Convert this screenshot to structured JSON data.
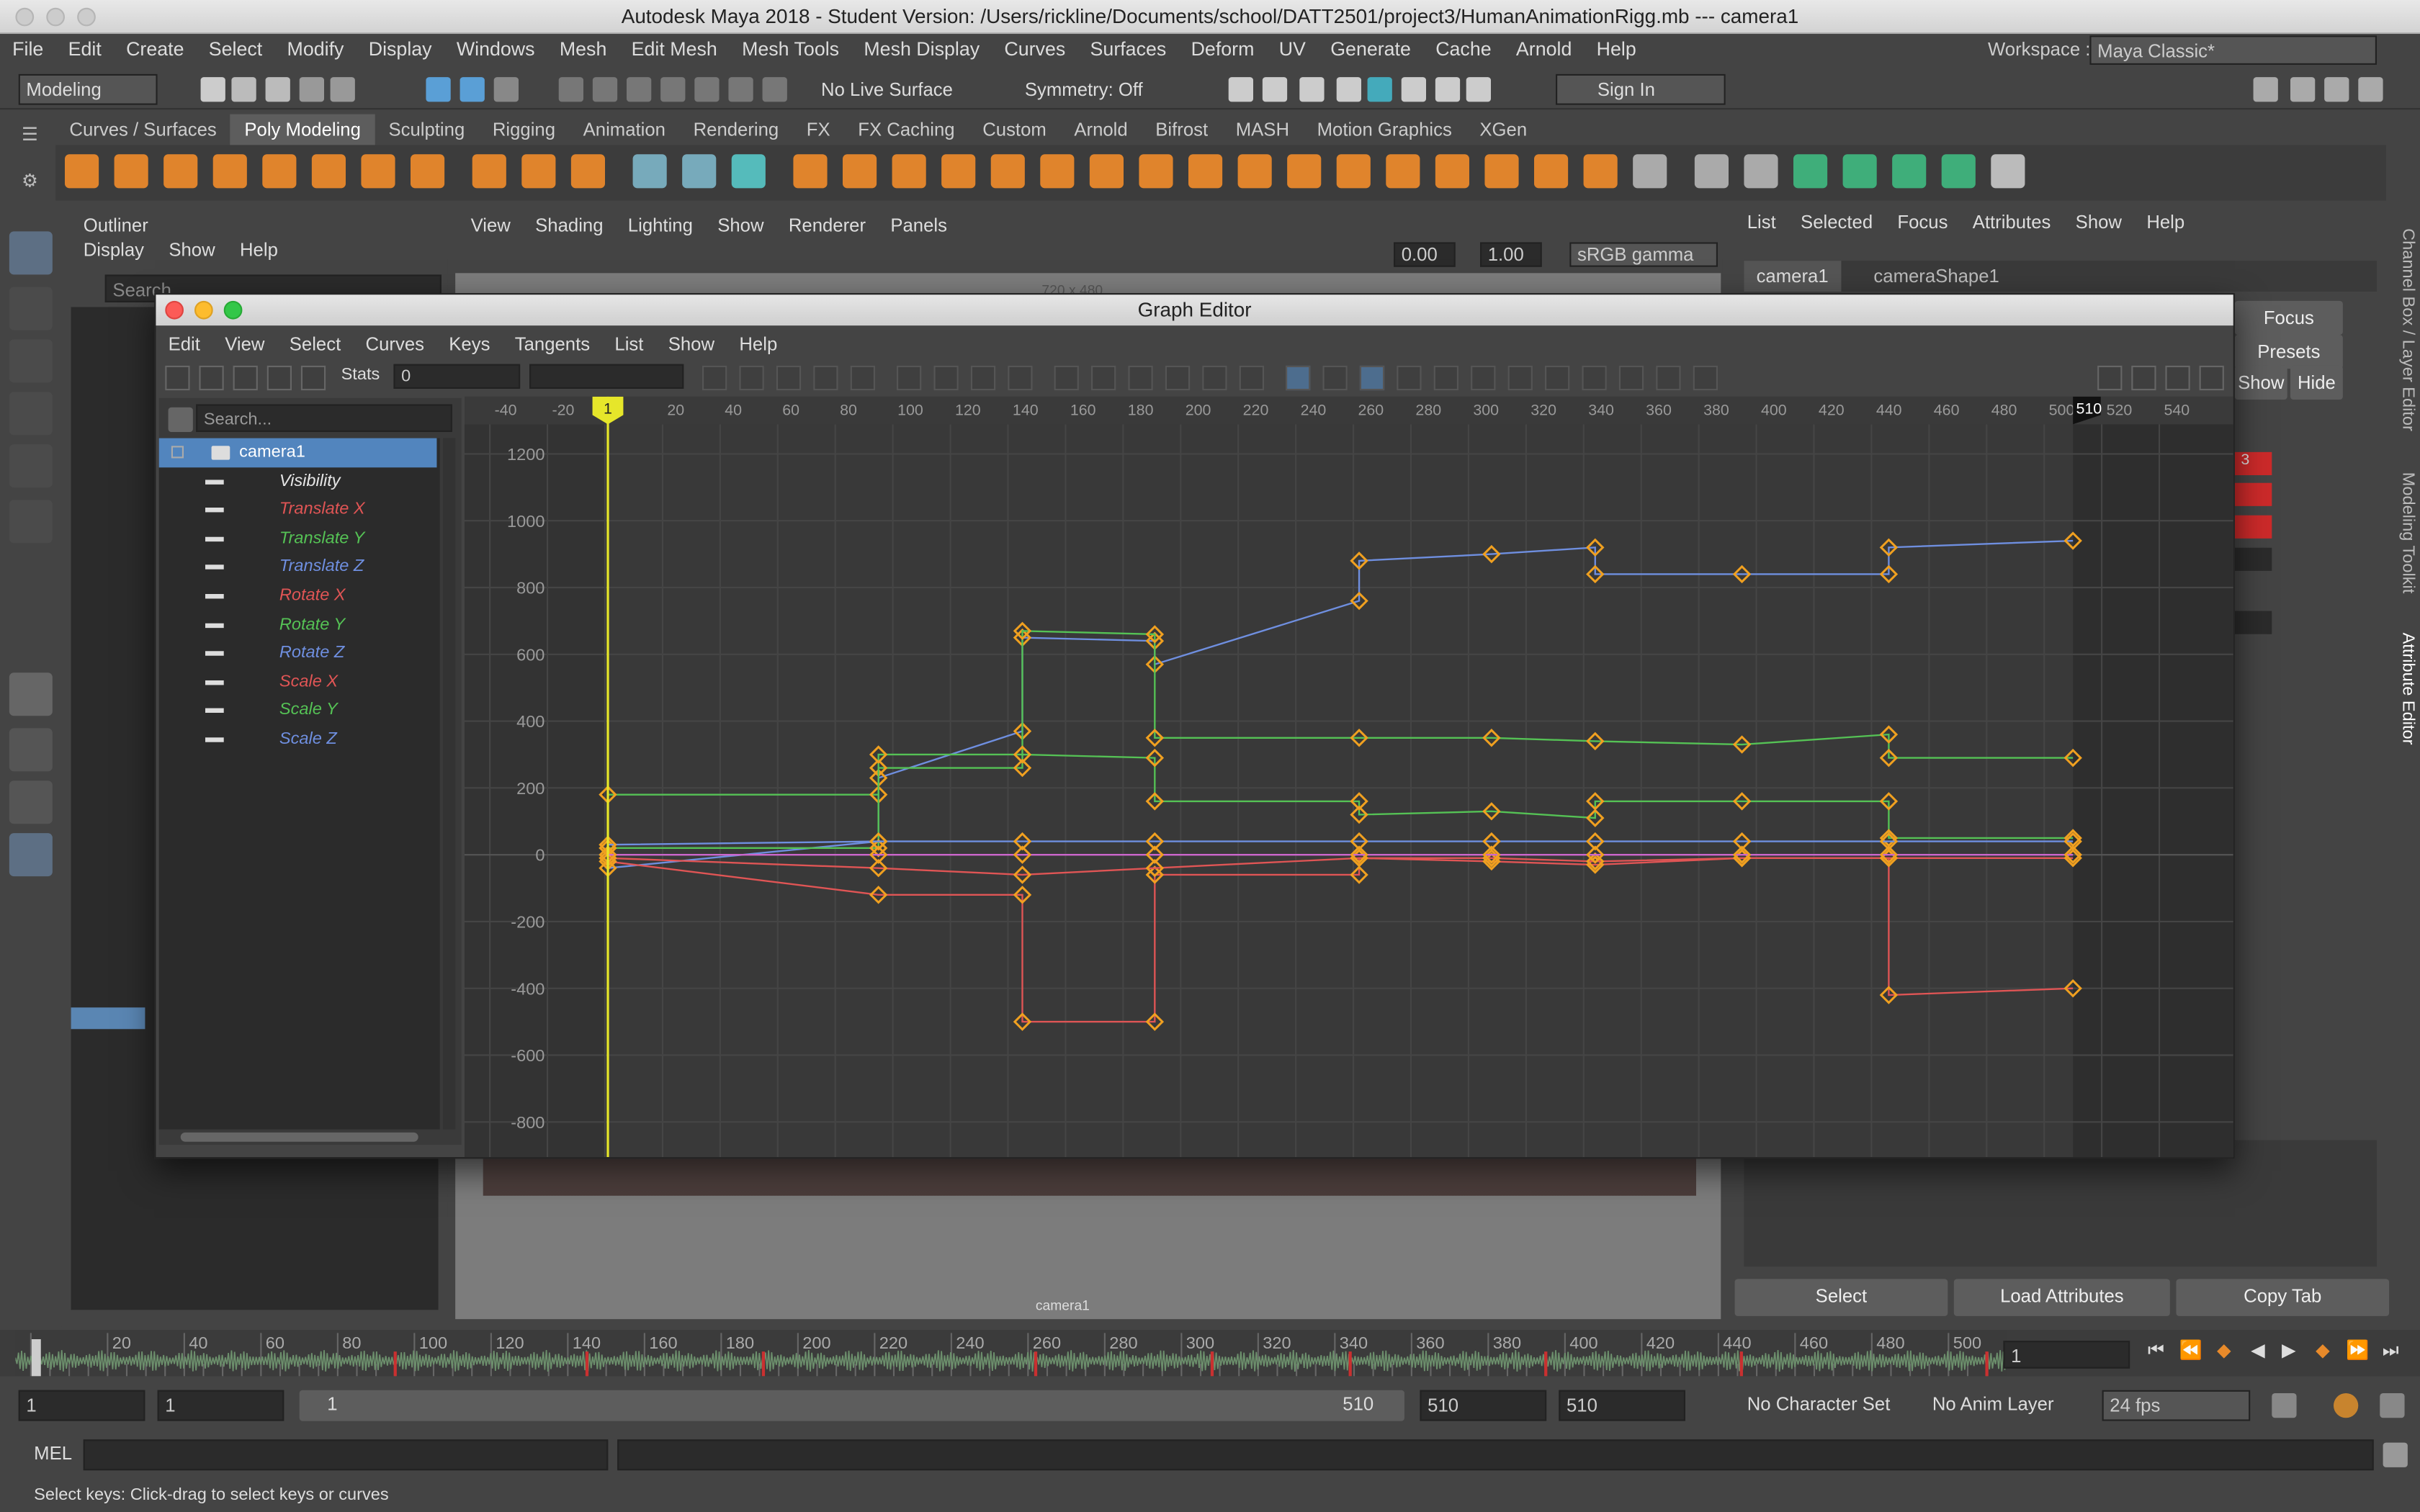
{
  "window": {
    "title": "Autodesk Maya 2018 - Student Version: /Users/rickline/Documents/school/DATT2501/project3/HumanAnimationRigg.mb   ---   camera1"
  },
  "menu": [
    "File",
    "Edit",
    "Create",
    "Select",
    "Modify",
    "Display",
    "Windows",
    "Mesh",
    "Edit Mesh",
    "Mesh Tools",
    "Mesh Display",
    "Curves",
    "Surfaces",
    "Deform",
    "UV",
    "Generate",
    "Cache",
    "Arnold",
    "Help"
  ],
  "workspace": {
    "label": "Workspace :",
    "value": "Maya Classic*"
  },
  "status": {
    "mode": "Modeling",
    "live_surface": "No Live Surface",
    "symmetry": "Symmetry: Off",
    "sign_in": "Sign In"
  },
  "shelf_tabs": [
    "Curves / Surfaces",
    "Poly Modeling",
    "Sculpting",
    "Rigging",
    "Animation",
    "Rendering",
    "FX",
    "FX Caching",
    "Custom",
    "Arnold",
    "Bifrost",
    "MASH",
    "Motion Graphics",
    "XGen"
  ],
  "outliner": {
    "title": "Outliner",
    "menu": [
      "Display",
      "Show",
      "Help"
    ],
    "search": "Search..."
  },
  "viewport": {
    "menu": [
      "View",
      "Shading",
      "Lighting",
      "Show",
      "Renderer",
      "Panels"
    ],
    "field1": "0.00",
    "field2": "1.00",
    "color_space": "sRGB gamma",
    "resolution": "720 x 480",
    "camera_label": "camera1"
  },
  "right_panel": {
    "menu": [
      "List",
      "Selected",
      "Focus",
      "Attributes",
      "Show",
      "Help"
    ],
    "tabs": [
      "camera1",
      "cameraShape1"
    ],
    "focus": "Focus",
    "presets": "Presets",
    "show": "Show",
    "hide": "Hide",
    "red_value": "3",
    "select": "Select",
    "load_attributes": "Load Attributes",
    "copy_tab": "Copy Tab"
  },
  "side_tabs": [
    "Channel Box / Layer Editor",
    "Modeling Toolkit",
    "Attribute Editor"
  ],
  "graph_editor": {
    "title": "Graph Editor",
    "menu": [
      "Edit",
      "View",
      "Select",
      "Curves",
      "Keys",
      "Tangents",
      "List",
      "Show",
      "Help"
    ],
    "stats_label": "Stats",
    "stats_value": "0",
    "search": "Search...",
    "object": "camera1",
    "channels": [
      {
        "label": "Visibility",
        "color": "#e6e6e6"
      },
      {
        "label": "Translate X",
        "color": "#e05555"
      },
      {
        "label": "Translate Y",
        "color": "#55c255"
      },
      {
        "label": "Translate Z",
        "color": "#6f8fe0"
      },
      {
        "label": "Rotate X",
        "color": "#e05555"
      },
      {
        "label": "Rotate Y",
        "color": "#55c255"
      },
      {
        "label": "Rotate Z",
        "color": "#6f8fe0"
      },
      {
        "label": "Scale X",
        "color": "#e05555"
      },
      {
        "label": "Scale Y",
        "color": "#55c255"
      },
      {
        "label": "Scale Z",
        "color": "#6f8fe0"
      }
    ],
    "current_frame_label": "1",
    "end_frame_label": "510",
    "x_ticks": [
      "-40",
      "-20",
      "20",
      "40",
      "60",
      "80",
      "100",
      "120",
      "140",
      "160",
      "180",
      "200",
      "220",
      "240",
      "260",
      "280",
      "300",
      "320",
      "340",
      "360",
      "380",
      "400",
      "420",
      "440",
      "460",
      "480",
      "500",
      "520",
      "540"
    ],
    "y_ticks": [
      "1200",
      "1000",
      "800",
      "600",
      "400",
      "200",
      "0",
      "-200",
      "-400",
      "-600",
      "-800"
    ]
  },
  "chart_data": {
    "type": "line",
    "xlabel": "",
    "ylabel": "",
    "xlim": [
      -50,
      555
    ],
    "ylim": [
      -850,
      1240
    ],
    "grid": true,
    "current_frame": 1,
    "series": [
      {
        "color": "#6f8fe0",
        "points": [
          [
            1,
            -40
          ],
          [
            95,
            40
          ],
          [
            95,
            230
          ],
          [
            145,
            370
          ],
          [
            145,
            650
          ],
          [
            191,
            640
          ],
          [
            191,
            570
          ],
          [
            262,
            760
          ],
          [
            262,
            880
          ],
          [
            308,
            900
          ],
          [
            344,
            920
          ],
          [
            344,
            840
          ],
          [
            395,
            840
          ],
          [
            446,
            840
          ],
          [
            446,
            920
          ],
          [
            510,
            940
          ]
        ]
      },
      {
        "color": "#55c255",
        "points": [
          [
            1,
            180
          ],
          [
            95,
            180
          ],
          [
            95,
            260
          ],
          [
            145,
            260
          ],
          [
            145,
            670
          ],
          [
            191,
            660
          ],
          [
            191,
            350
          ],
          [
            262,
            350
          ],
          [
            308,
            350
          ],
          [
            344,
            340
          ],
          [
            395,
            330
          ],
          [
            446,
            360
          ],
          [
            446,
            290
          ],
          [
            510,
            290
          ]
        ]
      },
      {
        "color": "#55c255",
        "points": [
          [
            1,
            20
          ],
          [
            95,
            20
          ],
          [
            95,
            300
          ],
          [
            145,
            300
          ],
          [
            191,
            290
          ],
          [
            191,
            160
          ],
          [
            262,
            160
          ],
          [
            262,
            120
          ],
          [
            308,
            130
          ],
          [
            344,
            110
          ],
          [
            344,
            160
          ],
          [
            395,
            160
          ],
          [
            446,
            160
          ],
          [
            446,
            50
          ],
          [
            510,
            50
          ]
        ]
      },
      {
        "color": "#6f8fe0",
        "points": [
          [
            1,
            30
          ],
          [
            95,
            40
          ],
          [
            145,
            40
          ],
          [
            191,
            40
          ],
          [
            262,
            40
          ],
          [
            308,
            40
          ],
          [
            344,
            40
          ],
          [
            395,
            40
          ],
          [
            446,
            40
          ],
          [
            510,
            40
          ]
        ]
      },
      {
        "color": "#e05555",
        "points": [
          [
            1,
            -20
          ],
          [
            95,
            -120
          ],
          [
            145,
            -120
          ],
          [
            145,
            -500
          ],
          [
            191,
            -500
          ],
          [
            191,
            -60
          ],
          [
            262,
            -60
          ],
          [
            262,
            -10
          ],
          [
            308,
            -20
          ],
          [
            344,
            -30
          ],
          [
            395,
            -10
          ],
          [
            446,
            -10
          ],
          [
            446,
            -420
          ],
          [
            510,
            -400
          ]
        ]
      },
      {
        "color": "#e05555",
        "points": [
          [
            1,
            -10
          ],
          [
            95,
            -40
          ],
          [
            145,
            -60
          ],
          [
            191,
            -40
          ],
          [
            262,
            -10
          ],
          [
            308,
            -10
          ],
          [
            344,
            -20
          ],
          [
            395,
            -10
          ],
          [
            446,
            -10
          ],
          [
            510,
            -10
          ]
        ]
      },
      {
        "color": "#cc66cc",
        "points": [
          [
            1,
            0
          ],
          [
            95,
            0
          ],
          [
            145,
            0
          ],
          [
            191,
            0
          ],
          [
            262,
            0
          ],
          [
            308,
            0
          ],
          [
            344,
            0
          ],
          [
            395,
            0
          ],
          [
            446,
            0
          ],
          [
            510,
            0
          ]
        ]
      }
    ]
  },
  "timeline": {
    "ticks": [
      "20",
      "40",
      "60",
      "80",
      "100",
      "120",
      "140",
      "160",
      "180",
      "200",
      "220",
      "240",
      "260",
      "280",
      "300",
      "320",
      "340",
      "360",
      "380",
      "400",
      "420",
      "440",
      "460",
      "480",
      "500"
    ],
    "current": "1"
  },
  "range": {
    "start": "1",
    "anim_start": "1",
    "slider_start": "1",
    "slider_end": "510",
    "end": "510",
    "anim_end": "510",
    "character_set": "No Character Set",
    "anim_layer": "No Anim Layer",
    "fps": "24 fps"
  },
  "mel": {
    "label": "MEL"
  },
  "help_line": "Select keys: Click-drag to select keys or curves"
}
